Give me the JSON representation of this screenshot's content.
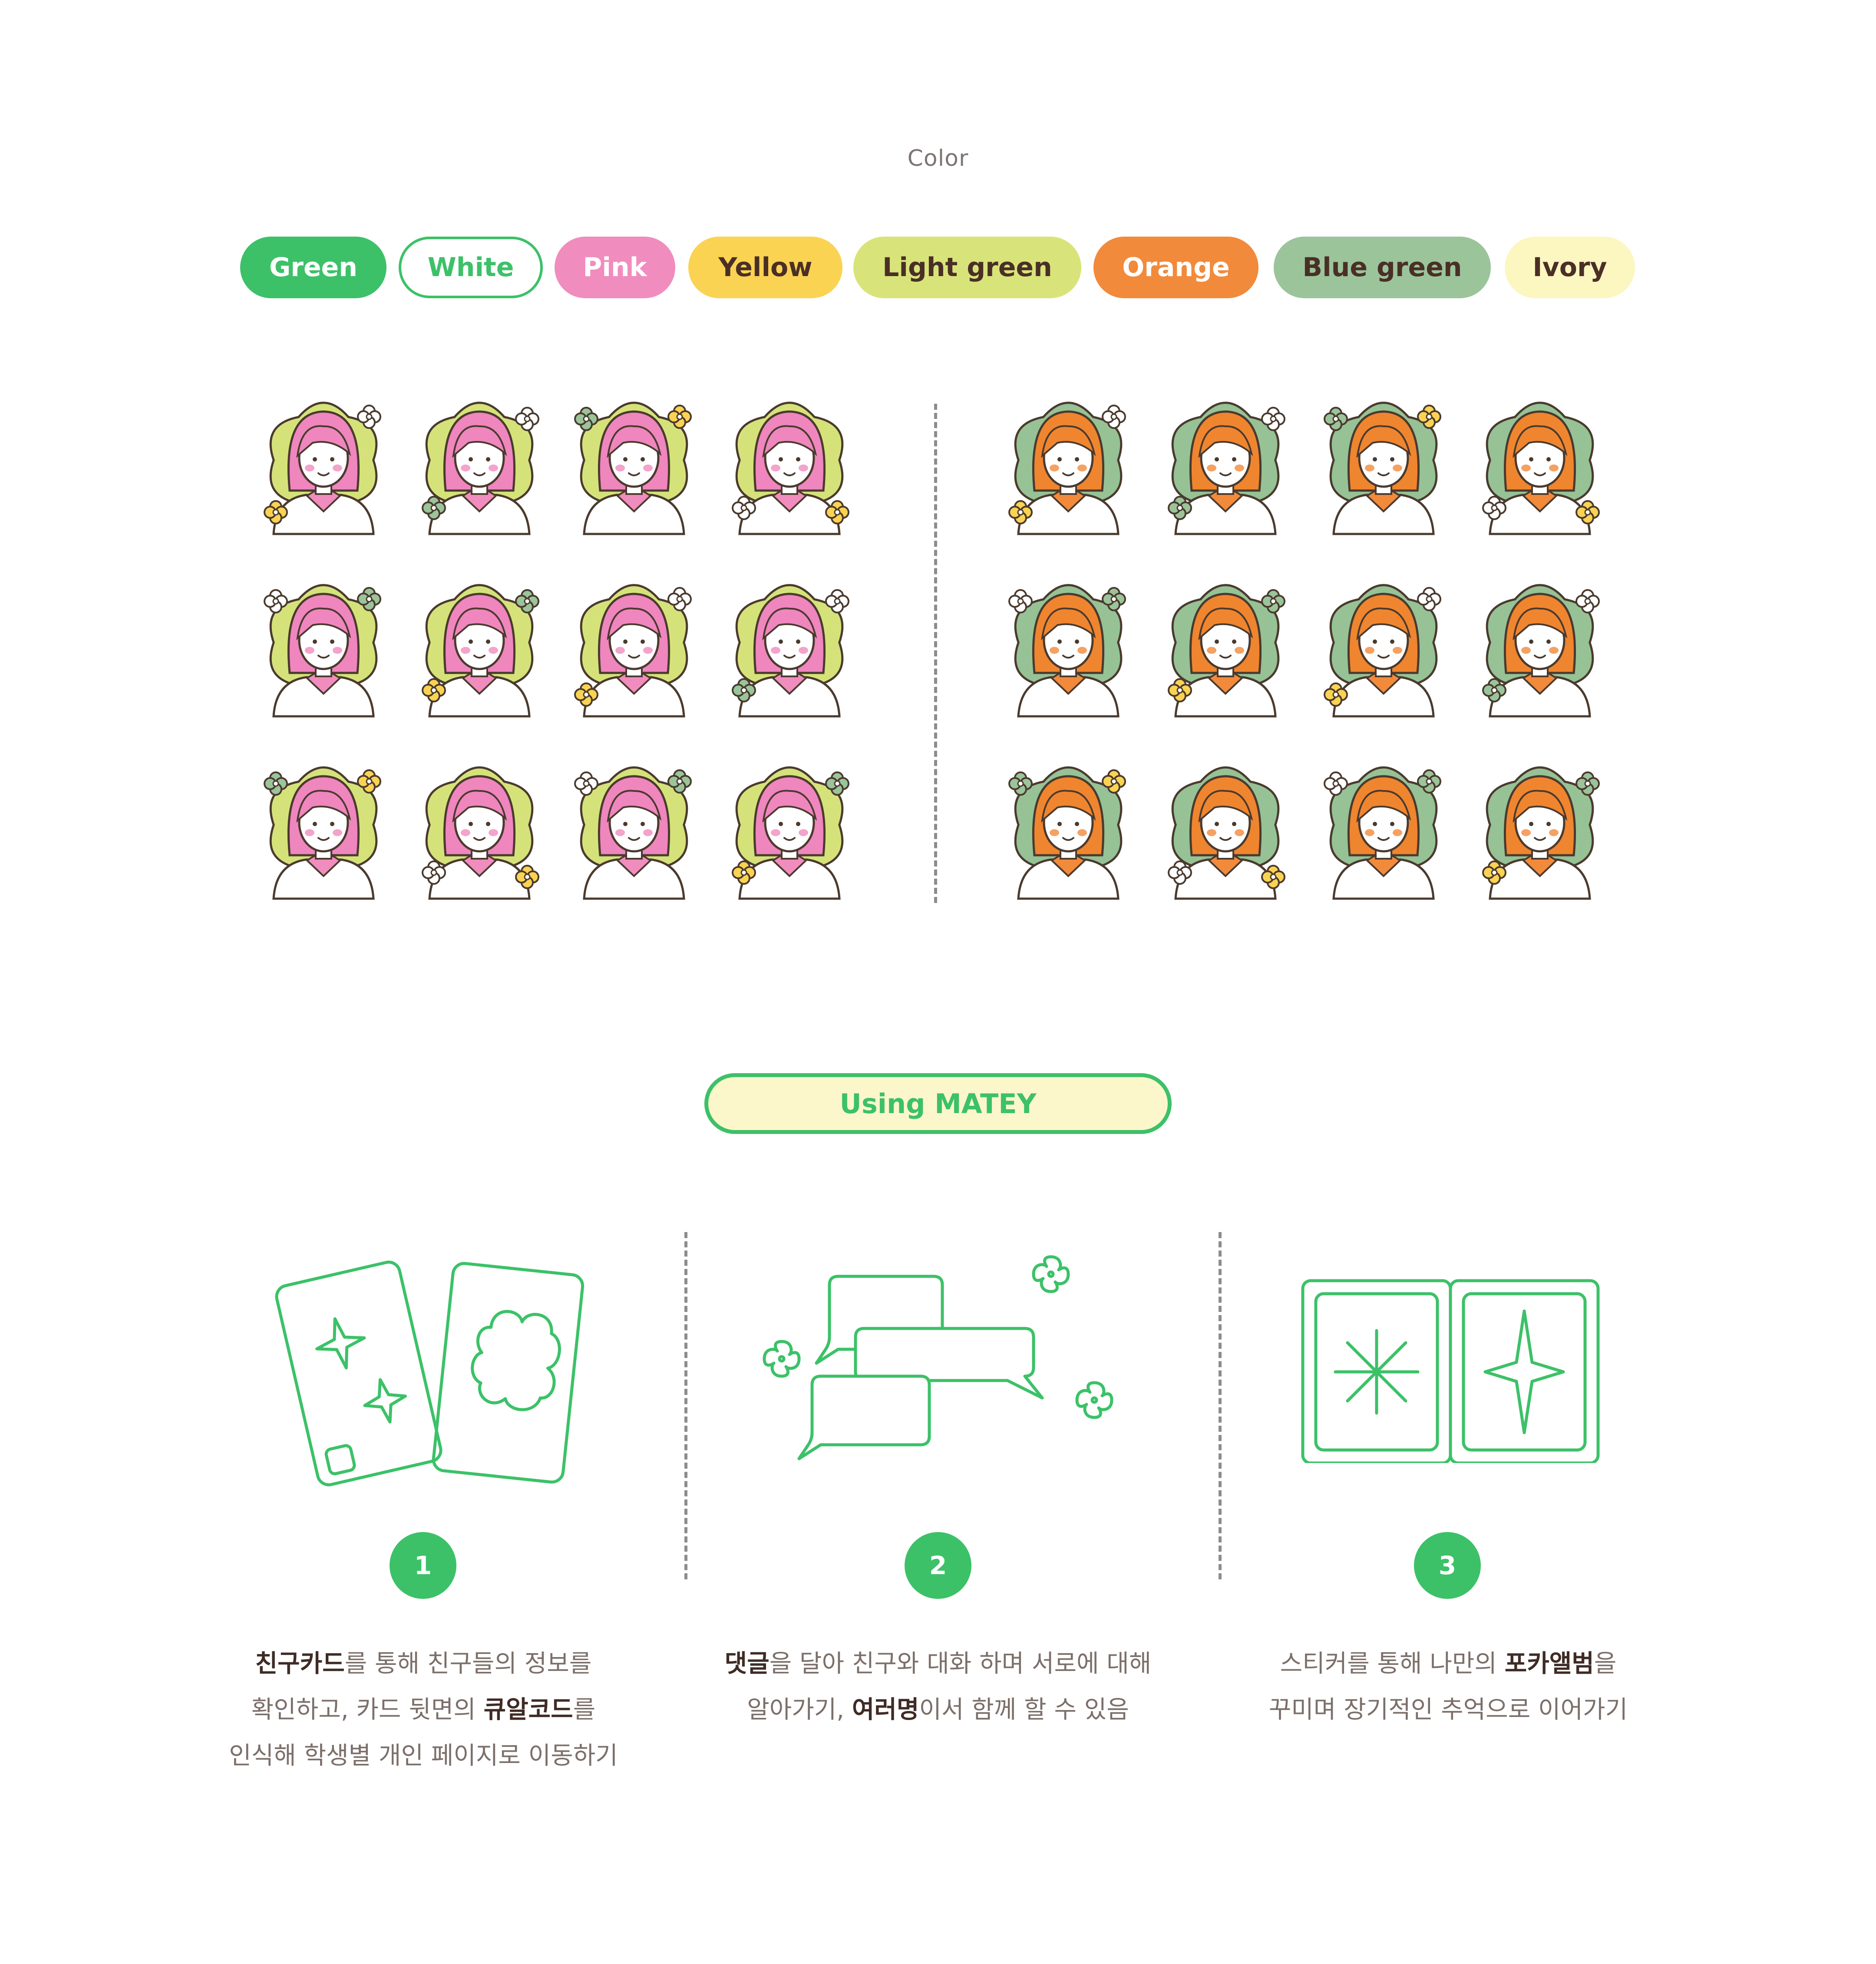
{
  "color_section": {
    "title": "Color",
    "swatches": [
      {
        "label": "Green",
        "bg": "#3cc168",
        "text": "#ffffff",
        "border": "#3cc168"
      },
      {
        "label": "White",
        "bg": "#ffffff",
        "text": "#3cc168",
        "border": "#3cc168"
      },
      {
        "label": "Pink",
        "bg": "#f18cbe",
        "text": "#ffffff",
        "border": "#f18cbe"
      },
      {
        "label": "Yellow",
        "bg": "#fbd352",
        "text": "#4a2f26",
        "border": "#fbd352"
      },
      {
        "label": "Light green",
        "bg": "#d8e47a",
        "text": "#4a2f26",
        "border": "#d8e47a"
      },
      {
        "label": "Orange",
        "bg": "#f28a3b",
        "text": "#ffffff",
        "border": "#f28a3b"
      },
      {
        "label": "Blue green",
        "bg": "#9bc49a",
        "text": "#4a2f26",
        "border": "#9bc49a"
      },
      {
        "label": "Ivory",
        "bg": "#fcf6c0",
        "text": "#4a2f26",
        "border": "#fcf6c0"
      }
    ]
  },
  "avatar_sets": {
    "left": {
      "hair": "#ef86be",
      "badge": "#d5e27a",
      "accent": "#f18cbe"
    },
    "right": {
      "hair": "#f0852f",
      "badge": "#96c296",
      "accent": "#f28a3b"
    }
  },
  "using_section": {
    "title": "Using MATEY",
    "steps": [
      {
        "number": "1",
        "line1_bold": "친구카드",
        "line1_rest": "를 통해 친구들의 정보를",
        "line2_pre": "확인하고, 카드 뒷면의 ",
        "line2_bold": "큐알코드",
        "line2_post": "를",
        "line3": "인식해 학생별 개인 페이지로 이동하기"
      },
      {
        "number": "2",
        "line1_bold": "댓글",
        "line1_rest": "을 달아 친구와 대화 하며 서로에 대해",
        "line2_pre": "알아가기, ",
        "line2_bold": "여러명",
        "line2_post": "이서 함께 할 수 있음"
      },
      {
        "number": "3",
        "line1_pre": "스티커를 통해 나만의 ",
        "line1_bold": "포카앨범",
        "line1_post": "을",
        "line2": "꾸미며 장기적인 추억으로 이어가기"
      }
    ]
  },
  "colors": {
    "green": "#3cc168",
    "outline": "#4a3a2e",
    "divider": "#8c8c8c"
  }
}
